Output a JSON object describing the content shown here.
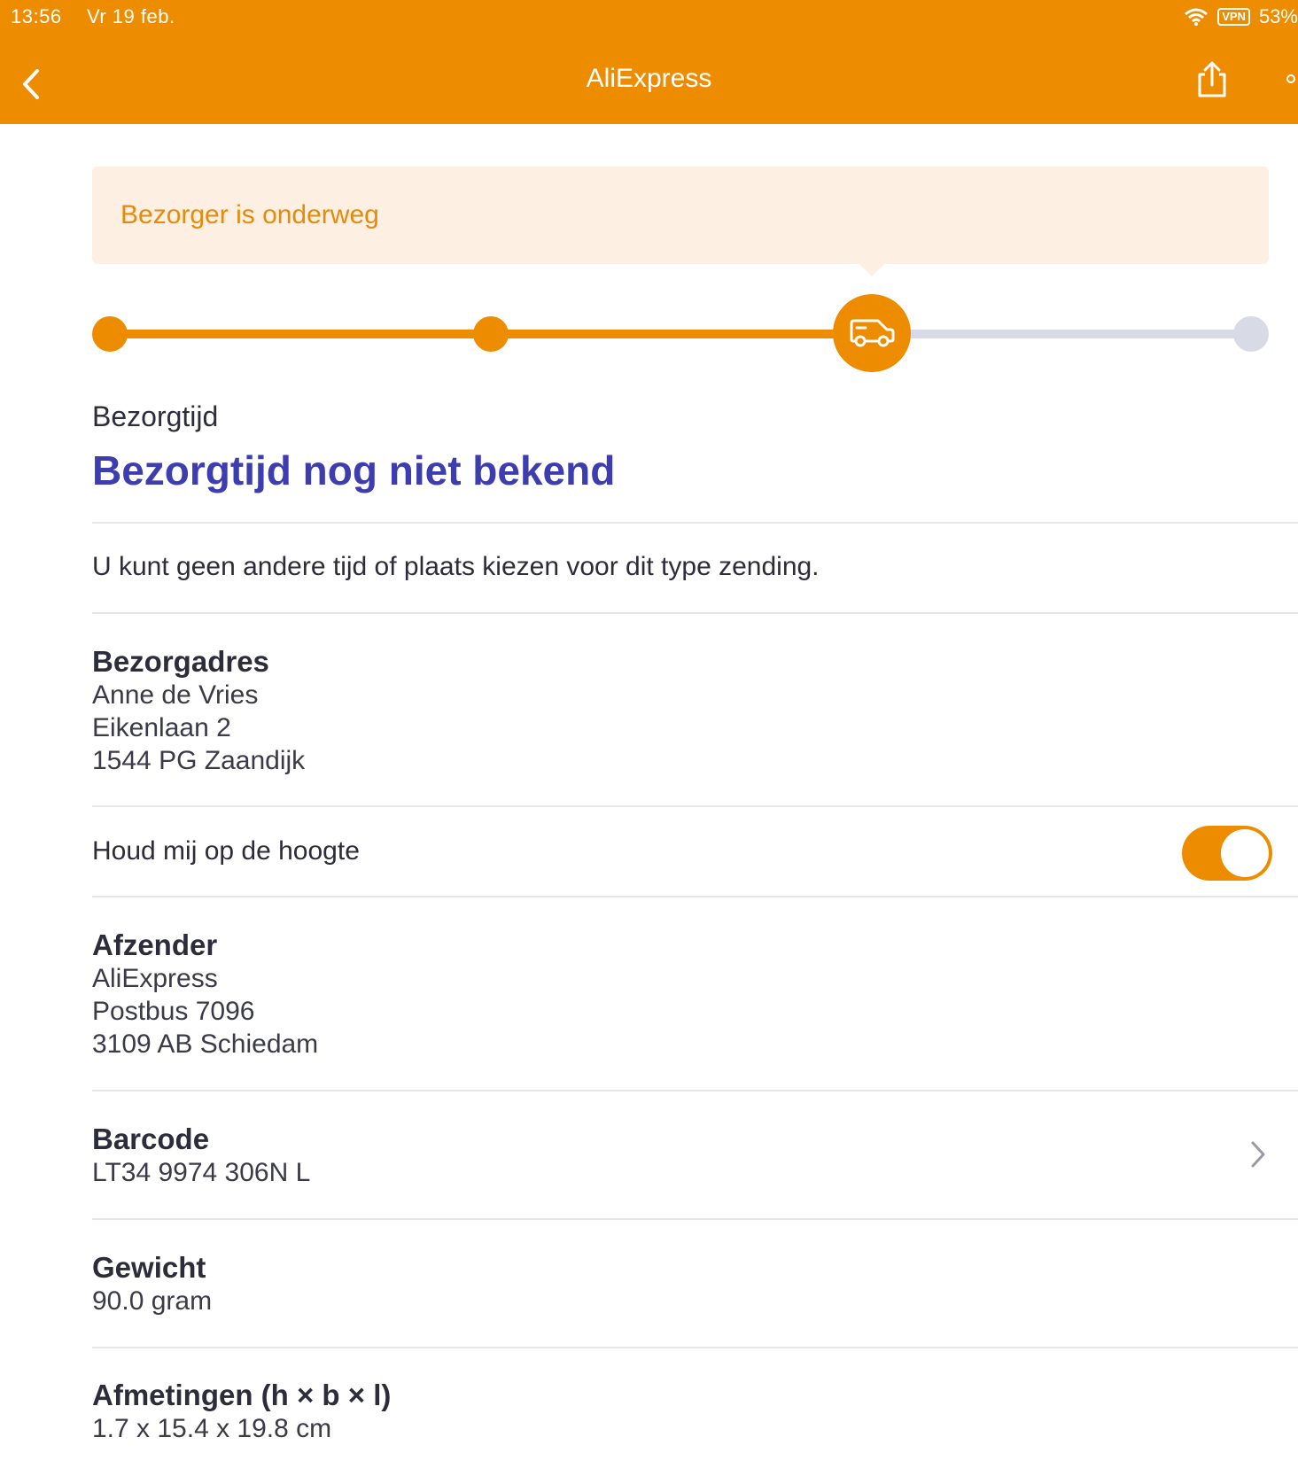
{
  "status_bar": {
    "time": "13:56",
    "date": "Vr 19 feb.",
    "vpn": "VPN",
    "battery": "53%"
  },
  "header": {
    "title": "AliExpress",
    "back_icon": "chevron-left-icon",
    "share_icon": "share-icon"
  },
  "banner": {
    "text": "Bezorger is onderweg"
  },
  "progress": {
    "steps": 4,
    "current_step": 3,
    "current_icon": "delivery-van-icon",
    "active_color": "#ee8c00",
    "inactive_color": "#d8dae6"
  },
  "delivery_time": {
    "label": "Bezorgtijd",
    "value": "Bezorgtijd nog niet bekend"
  },
  "notice": "U kunt geen andere tijd of plaats kiezen voor dit type zending.",
  "address": {
    "heading": "Bezorgadres",
    "name": "Anne de Vries",
    "street": "Eikenlaan 2",
    "city": "1544 PG Zaandijk"
  },
  "notify": {
    "label": "Houd mij op de hoogte",
    "enabled": true
  },
  "sender": {
    "heading": "Afzender",
    "name": "AliExpress",
    "street": "Postbus 7096",
    "city": "3109 AB Schiedam"
  },
  "barcode": {
    "heading": "Barcode",
    "value": "LT34 9974 306N L"
  },
  "weight": {
    "heading": "Gewicht",
    "value": "90.0 gram"
  },
  "dimensions": {
    "heading": "Afmetingen (h × b × l)",
    "value": "1.7 x 15.4 x 19.8 cm"
  },
  "colors": {
    "brand": "#ee8c00",
    "title_blue": "#3d3db0",
    "banner_bg": "#fdf0e2"
  }
}
